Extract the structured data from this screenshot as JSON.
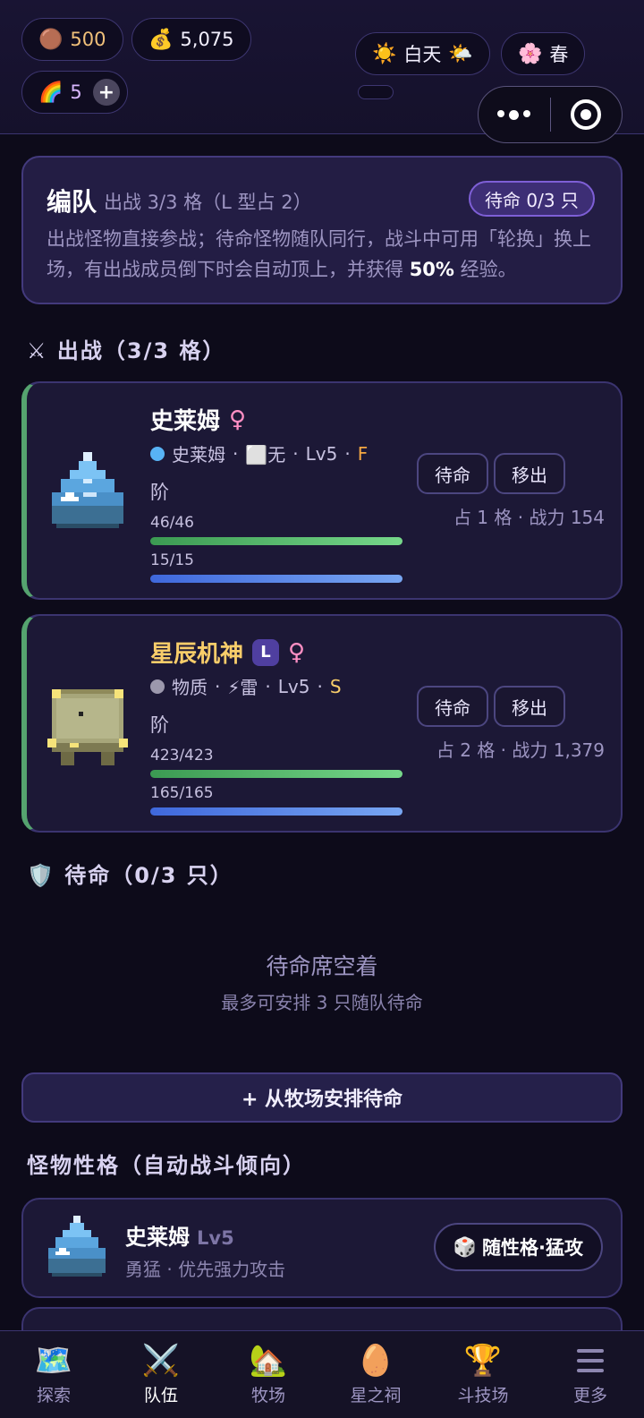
{
  "status": {
    "copper": "500",
    "gold": "5,075",
    "rainbow": "5",
    "time_label": "白天",
    "season_label": "春"
  },
  "formation": {
    "title": "编队",
    "subtitle": "出战 3/3 格（L 型占 2）",
    "standby_badge": "待命 0/3 只",
    "desc_part1": "出战怪物直接参战；待命怪物随队同行，战斗中可用「轮换」换上场，有出战成员倒下时会自动顶上，并获得 ",
    "desc_bold": "50%",
    "desc_part2": " 经验。"
  },
  "deploy_section": {
    "title": "出战（3/3 格）"
  },
  "deployed": [
    {
      "name": "史莱姆",
      "gender": "♀",
      "species": "史莱姆",
      "element": "⬜无",
      "level": "Lv5",
      "grade": "F",
      "rank": "阶",
      "hp": "46/46",
      "hp_fraction": 1.0,
      "mp": "15/15",
      "mp_fraction": 1.0,
      "standby_btn": "待命",
      "remove_btn": "移出",
      "meta": "占 1 格 · 战力 154",
      "dot_color": "#58b3f5"
    },
    {
      "name": "星辰机神",
      "badge": "L",
      "gender": "♀",
      "species": "物质",
      "element": "⚡雷",
      "level": "Lv5",
      "grade": "S",
      "rank": "阶",
      "hp": "423/423",
      "hp_fraction": 1.0,
      "mp": "165/165",
      "mp_fraction": 1.0,
      "standby_btn": "待命",
      "remove_btn": "移出",
      "meta": "占 2 格 · 战力 1,379",
      "dot_color": "#9c98ad"
    }
  ],
  "standby_section": {
    "title": "待命（0/3 只）",
    "empty_title": "待命席空着",
    "empty_sub": "最多可安排 3 只随队待命"
  },
  "arrange_button": "+ 从牧场安排待命",
  "personality_section": {
    "title": "怪物性格（自动战斗倾向）",
    "items": [
      {
        "name": "史莱姆",
        "level": "Lv5",
        "desc": "勇猛 · 优先强力攻击",
        "tag": "随性格·猛攻"
      }
    ]
  },
  "nav": [
    {
      "label": "探索",
      "icon": "map-icon"
    },
    {
      "label": "队伍",
      "icon": "crossed-swords-icon",
      "active": true
    },
    {
      "label": "牧场",
      "icon": "house-icon"
    },
    {
      "label": "星之祠",
      "icon": "egg-icon"
    },
    {
      "label": "斗技场",
      "icon": "trophy-icon"
    },
    {
      "label": "更多",
      "icon": "menu-icon"
    }
  ],
  "colors": {
    "accent_purple": "#7e5fd6",
    "hp_green": "#5ec474",
    "mp_blue": "#5a88ea",
    "gold_text": "#f8cd6a"
  }
}
